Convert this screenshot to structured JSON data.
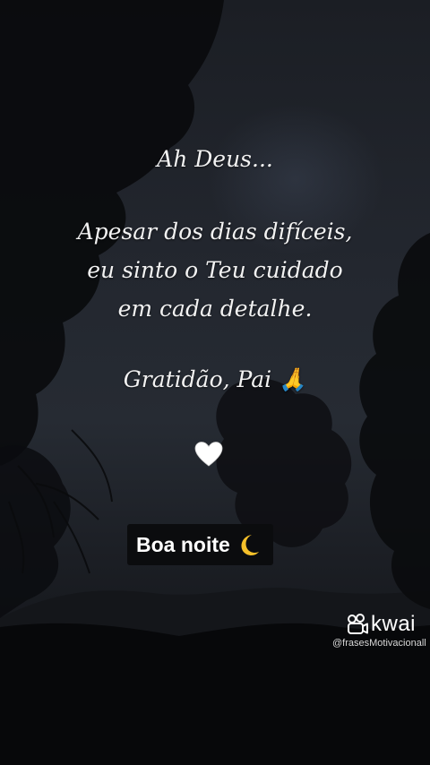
{
  "quote": {
    "line1": "Ah Deus...",
    "line2": "Apesar dos dias difíceis,",
    "line3": "eu sinto o Teu cuidado",
    "line4": "em cada detalhe.",
    "line5": "Gratidão, Pai 🙏"
  },
  "heart": {
    "icon": "white-heart-icon",
    "color": "#ffffff"
  },
  "badge": {
    "text": "Boa noite",
    "icon": "crescent-moon-icon",
    "moon_color": "#f5c02a",
    "background": "#0b0c0e"
  },
  "watermark": {
    "brand": "kwai",
    "handle": "@frasesMotivacionall"
  },
  "colors": {
    "text": "#f2f2f2",
    "sky": "#262b33",
    "foliage": "#07080a"
  }
}
